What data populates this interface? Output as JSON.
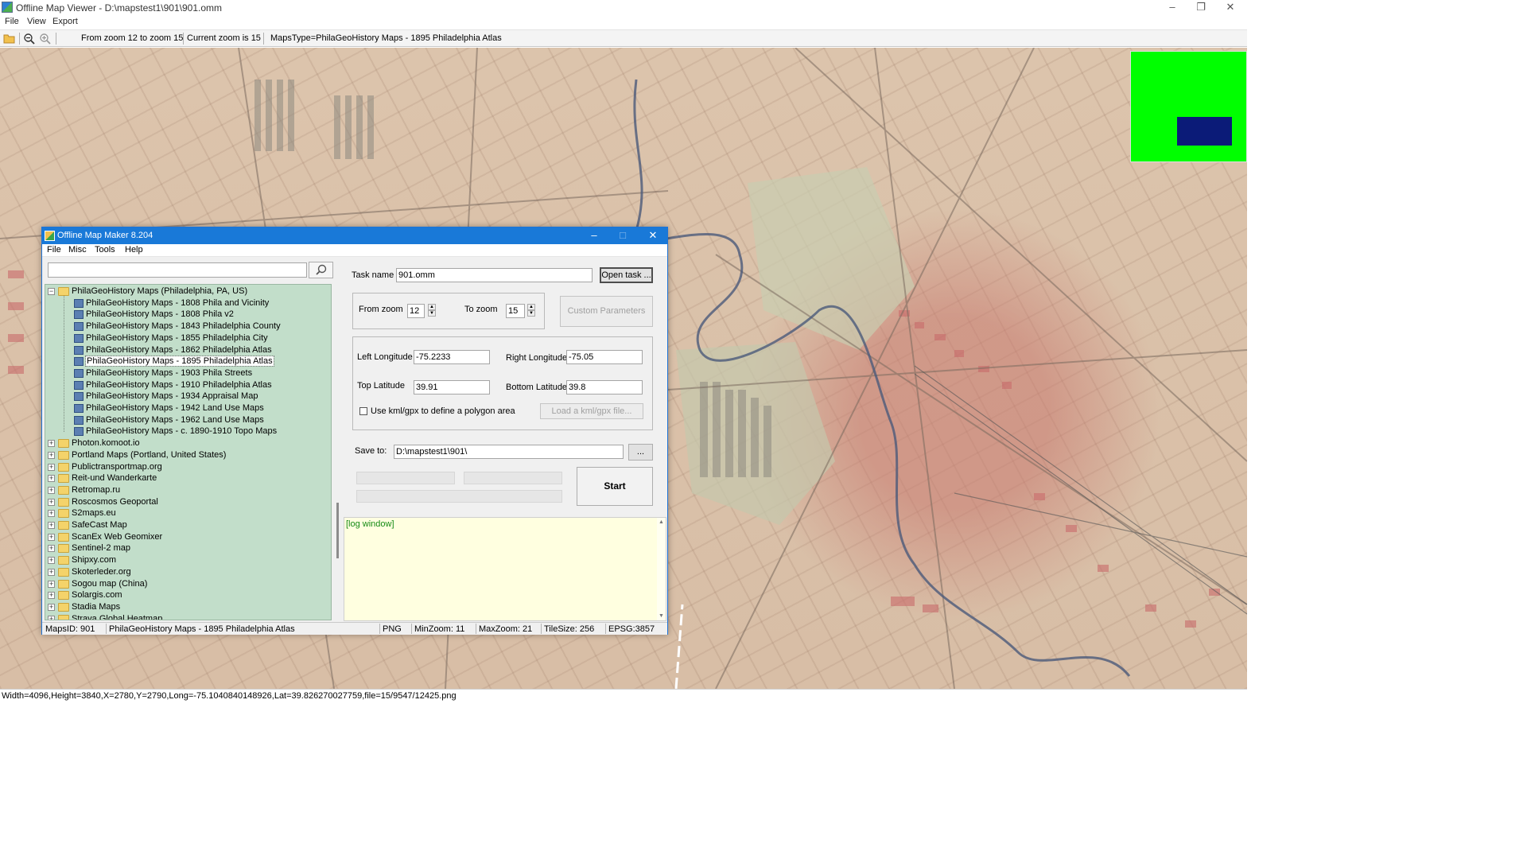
{
  "window": {
    "title": "Offline Map Viewer - D:\\mapstest1\\901\\901.omm"
  },
  "menu": [
    "File",
    "View",
    "Export"
  ],
  "toolbar": {
    "zoom_range": "From zoom 12 to zoom 15",
    "current_zoom": "Current zoom is 15",
    "maps_type": "MapsType=PhilaGeoHistory Maps - 1895 Philadelphia Atlas"
  },
  "overview": {
    "colors": {
      "background": "#00ff00",
      "viewport": "#0b1b78"
    }
  },
  "status": "Width=4096,Height=3840,X=2780,Y=2790,Long=-75.1040840148926,Lat=39.826270027759,file=15/9547/12425.png",
  "dialog": {
    "title": "Offline Map Maker 8.204",
    "menu": [
      "File",
      "Misc",
      "Tools",
      "Help"
    ],
    "search": {
      "value": ""
    },
    "tree": {
      "expanded_group": "PhilaGeoHistory Maps (Philadelphia, PA, US)",
      "children": [
        "PhilaGeoHistory Maps - 1808 Phila and Vicinity",
        "PhilaGeoHistory Maps - 1808 Phila v2",
        "PhilaGeoHistory Maps - 1843 Philadelphia County",
        "PhilaGeoHistory Maps - 1855 Philadelphia City",
        "PhilaGeoHistory Maps - 1862 Philadelphia Atlas",
        "PhilaGeoHistory Maps - 1895 Philadelphia Atlas",
        "PhilaGeoHistory Maps - 1903 Phila Streets",
        "PhilaGeoHistory Maps - 1910 Philadelphia Atlas",
        "PhilaGeoHistory Maps - 1934 Appraisal Map",
        "PhilaGeoHistory Maps - 1942 Land Use Maps",
        "PhilaGeoHistory Maps - 1962 Land Use Maps",
        "PhilaGeoHistory Maps - c. 1890-1910 Topo Maps"
      ],
      "selected_index": 5,
      "groups": [
        "Photon.komoot.io",
        "Portland Maps (Portland, United States)",
        "Publictransportmap.org",
        "Reit-und Wanderkarte",
        "Retromap.ru",
        "Roscosmos Geoportal",
        "S2maps.eu",
        "SafeCast Map",
        "ScanEx Web Geomixer",
        "Sentinel-2 map",
        "Shipxy.com",
        "Skoterleder.org",
        "Sogou map (China)",
        "Solargis.com",
        "Stadia Maps",
        "Strava Global Heatmap"
      ]
    },
    "task": {
      "label": "Task name",
      "value": "901.omm",
      "open_button": "Open task ..."
    },
    "zoom": {
      "from_label": "From zoom",
      "from_value": "12",
      "to_label": "To zoom",
      "to_value": "15",
      "custom_button": "Custom Parameters"
    },
    "coords": {
      "left_label": "Left Longitude",
      "left_value": "-75.2233",
      "right_label": "Right Longitude",
      "right_value": "-75.05",
      "top_label": "Top Latitude",
      "top_value": "39.91",
      "bottom_label": "Bottom Latitude",
      "bottom_value": "39.8",
      "kml_checkbox": "Use kml/gpx to define a polygon area",
      "kml_checked": false,
      "kml_button": "Load a kml/gpx file..."
    },
    "save": {
      "label": "Save to:",
      "value": "D:\\mapstest1\\901\\",
      "browse": "..."
    },
    "start_button": "Start",
    "log": "[log window]",
    "statusbar": {
      "maps_id": "MapsID: 901",
      "maps_name": "PhilaGeoHistory Maps - 1895 Philadelphia Atlas",
      "format": "PNG",
      "min_zoom": "MinZoom: 11",
      "max_zoom": "MaxZoom: 21",
      "tile_size": "TileSize: 256",
      "epsg": "EPSG:3857"
    }
  }
}
